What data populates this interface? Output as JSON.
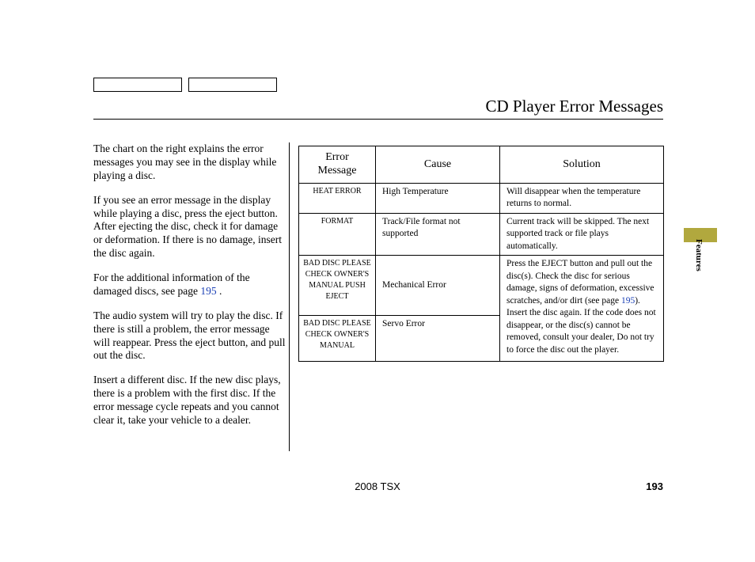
{
  "title": "CD Player Error Messages",
  "paragraphs": {
    "p1": "The chart on the right explains the error messages you may see in the display while playing a disc.",
    "p2": "If you see an error message in the display while playing a disc, press the eject button. After ejecting the disc, check it for damage or deformation. If there is no damage, insert the disc again.",
    "p3a": "For the additional information of the damaged discs, see page ",
    "p3_link": "195",
    "p3b": " .",
    "p4": "The audio system will try to play the disc. If there is still a problem, the error message will reappear. Press the eject button, and pull out the disc.",
    "p5": "Insert a different disc. If the new disc plays, there is a problem with the first disc. If the error message cycle repeats and you cannot clear it, take your vehicle to a dealer."
  },
  "table": {
    "headers": {
      "msg": "Error Message",
      "cause": "Cause",
      "solution": "Solution"
    },
    "rows": {
      "r1": {
        "msg": "HEAT ERROR",
        "cause": "High Temperature",
        "solution": "Will disappear when the temperature returns to normal."
      },
      "r2": {
        "msg": "FORMAT",
        "cause": "Track/File format not supported",
        "solution": "Current track will be skipped. The next supported track or file plays automatically."
      },
      "r3": {
        "msg": "BAD DISC PLEASE CHECK OWNER'S MANUAL PUSH EJECT",
        "cause": "Mechanical Error"
      },
      "r4": {
        "msg": "BAD DISC PLEASE CHECK OWNER'S MANUAL",
        "cause": "Servo Error"
      },
      "merged_solution_a": "Press the EJECT button and pull out the disc(s). Check the disc for serious damage, signs of deformation, excessive scratches, and/or dirt (see page ",
      "merged_link": "195",
      "merged_solution_b": "). Insert the disc again. If the code does not disappear, or the disc(s) cannot be removed, consult your dealer, Do not try to force the disc out the player."
    }
  },
  "side_label": "Features",
  "footer_model": "2008  TSX",
  "footer_page": "193"
}
